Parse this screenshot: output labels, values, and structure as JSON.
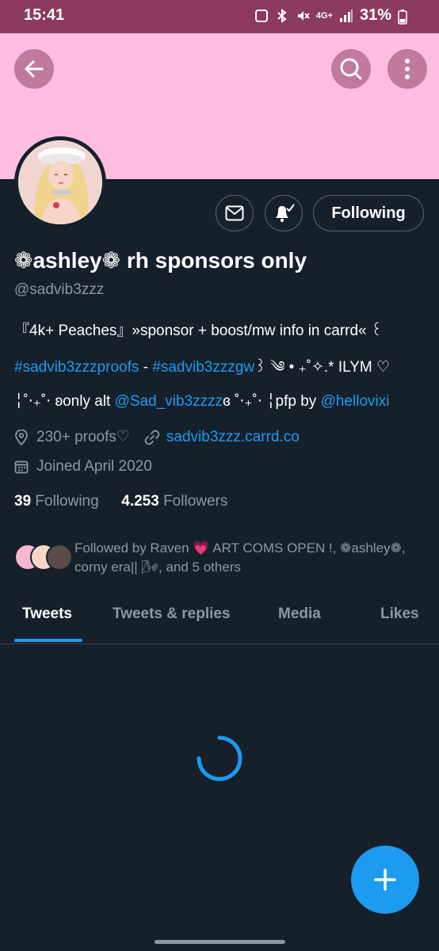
{
  "status_bar": {
    "time": "15:41",
    "network": "4G+",
    "battery": "31%"
  },
  "header": {
    "back_icon": "arrow-left-icon",
    "search_icon": "search-icon",
    "more_icon": "more-vertical-icon",
    "banner_color": "#ffbde2"
  },
  "profile": {
    "display_name": "❁ashley❁ rh sponsors only",
    "handle": "@sadvib3zzz",
    "follow_label": "Following",
    "bio": {
      "line1": "『4k+ Peaches』»sponsor + boost/mw info in carrd« ꒰",
      "line2_tag1": "#sadvib3zzzproofs",
      "line2_sep": " - ",
      "line2_tag2": "#sadvib3zzzgw",
      "line2_tail": "꒱ ༄ • ₊˚✧.* ILYM ♡",
      "line3_pre": "╎˚‧₊˚‧ ʚonly alt ",
      "line3_mention1": "@Sad_vib3zzzz",
      "line3_mid": "ɞ ˚‧₊˚‧ ╎pfp by ",
      "line3_mention2": "@hellovixi"
    },
    "location": "230+ proofs♡",
    "website": "sadvib3zzz.carrd.co",
    "joined": "Joined April 2020",
    "following_count": "39",
    "following_label": "Following",
    "followers_count": "4.253",
    "followers_label": "Followers",
    "followed_by": "Followed by Raven 💗 ART COMS OPEN !, ❁ashley❁, corny era|| 🌬, and 5 others"
  },
  "tabs": [
    {
      "label": "Tweets",
      "active": true
    },
    {
      "label": "Tweets & replies",
      "active": false
    },
    {
      "label": "Media",
      "active": false
    },
    {
      "label": "Likes",
      "active": false
    }
  ],
  "colors": {
    "background": "#15202b",
    "accent": "#1d9bf0",
    "status_bar": "#8c3a5f",
    "muted_text": "#8b98a5"
  }
}
